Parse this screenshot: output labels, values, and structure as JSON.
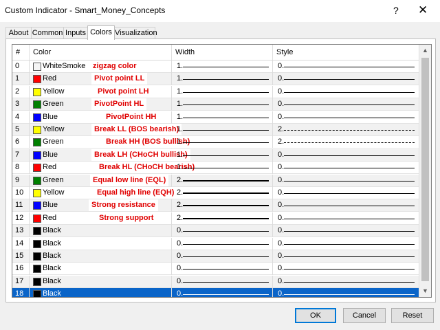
{
  "window": {
    "title": "Custom Indicator - Smart_Money_Concepts",
    "help": "?",
    "close": "✕"
  },
  "tabs": [
    {
      "label": "About"
    },
    {
      "label": "Common"
    },
    {
      "label": "Inputs"
    },
    {
      "label": "Colors"
    },
    {
      "label": "Visualization"
    }
  ],
  "active_tab": "Colors",
  "grid": {
    "headers": {
      "num": "#",
      "color": "Color",
      "width": "Width",
      "style": "Style"
    },
    "rows": [
      {
        "num": "0",
        "color": "WhiteSmoke",
        "hex": "#f5f5f5",
        "annotation": "zigzag color",
        "width": "1.",
        "style": "0.",
        "wthick": 1,
        "dashed": false
      },
      {
        "num": "1",
        "color": "Red",
        "hex": "#ff0000",
        "annotation": "Pivot point LL",
        "width": "1.",
        "style": "0.",
        "wthick": 1,
        "dashed": false
      },
      {
        "num": "2",
        "color": "Yellow",
        "hex": "#ffff00",
        "annotation": "Pivot point LH",
        "width": "1.",
        "style": "0.",
        "wthick": 1,
        "dashed": false
      },
      {
        "num": "3",
        "color": "Green",
        "hex": "#008000",
        "annotation": "PivotPoint HL",
        "width": "1.",
        "style": "0.",
        "wthick": 1,
        "dashed": false
      },
      {
        "num": "4",
        "color": "Blue",
        "hex": "#0000ff",
        "annotation": "PivotPoint HH",
        "width": "1.",
        "style": "0.",
        "wthick": 1,
        "dashed": false
      },
      {
        "num": "5",
        "color": "Yellow",
        "hex": "#ffff00",
        "annotation": "Break LL (BOS bearish)",
        "width": "1.",
        "style": "2.",
        "wthick": 1,
        "dashed": true
      },
      {
        "num": "6",
        "color": "Green",
        "hex": "#008000",
        "annotation": "Break HH (BOS bullish)",
        "width": "1.",
        "style": "2.",
        "wthick": 1,
        "dashed": true
      },
      {
        "num": "7",
        "color": "Blue",
        "hex": "#0000ff",
        "annotation": "Break LH (CHoCH bullish)",
        "width": "1.",
        "style": "0.",
        "wthick": 1,
        "dashed": false
      },
      {
        "num": "8",
        "color": "Red",
        "hex": "#ff0000",
        "annotation": "Break HL (CHoCH bearish)",
        "width": "1.",
        "style": "0.",
        "wthick": 1,
        "dashed": false
      },
      {
        "num": "9",
        "color": "Green",
        "hex": "#008000",
        "annotation": "Equal low line (EQL)",
        "width": "2.",
        "style": "0.",
        "wthick": 2,
        "dashed": false
      },
      {
        "num": "10",
        "color": "Yellow",
        "hex": "#ffff00",
        "annotation": "Equal high line (EQH)",
        "width": "2.",
        "style": "0.",
        "wthick": 2,
        "dashed": false
      },
      {
        "num": "11",
        "color": "Blue",
        "hex": "#0000ff",
        "annotation": "Strong resistance",
        "width": "2.",
        "style": "0.",
        "wthick": 2,
        "dashed": false
      },
      {
        "num": "12",
        "color": "Red",
        "hex": "#ff0000",
        "annotation": "Strong support",
        "width": "2.",
        "style": "0.",
        "wthick": 2,
        "dashed": false
      },
      {
        "num": "13",
        "color": "Black",
        "hex": "#000000",
        "annotation": "",
        "width": "0.",
        "style": "0.",
        "wthick": 1,
        "dashed": false
      },
      {
        "num": "14",
        "color": "Black",
        "hex": "#000000",
        "annotation": "",
        "width": "0.",
        "style": "0.",
        "wthick": 1,
        "dashed": false
      },
      {
        "num": "15",
        "color": "Black",
        "hex": "#000000",
        "annotation": "",
        "width": "0.",
        "style": "0.",
        "wthick": 1,
        "dashed": false
      },
      {
        "num": "16",
        "color": "Black",
        "hex": "#000000",
        "annotation": "",
        "width": "0.",
        "style": "0.",
        "wthick": 1,
        "dashed": false
      },
      {
        "num": "17",
        "color": "Black",
        "hex": "#000000",
        "annotation": "",
        "width": "0.",
        "style": "0.",
        "wthick": 1,
        "dashed": false
      },
      {
        "num": "18",
        "color": "Black",
        "hex": "#000000",
        "annotation": "",
        "width": "0.",
        "style": "0.",
        "wthick": 1,
        "dashed": false,
        "selected": true
      }
    ]
  },
  "buttons": {
    "ok": "OK",
    "cancel": "Cancel",
    "reset": "Reset"
  },
  "colors": {
    "selection": "#0a64c8",
    "annotation": "#e00000",
    "ok_border": "#0078d7"
  }
}
